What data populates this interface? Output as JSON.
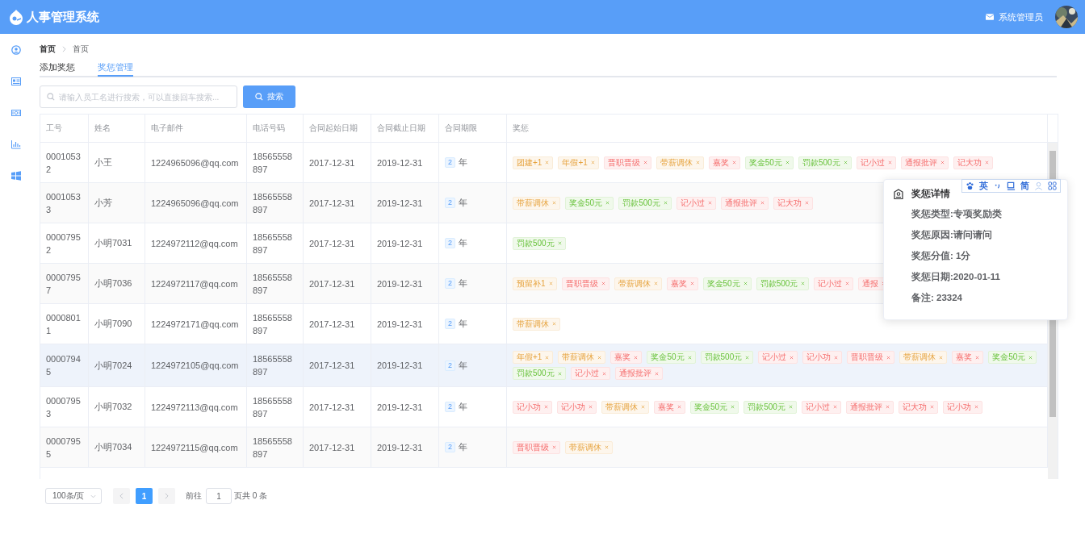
{
  "header": {
    "app_title": "人事管理系统",
    "user_name": "系统管理员"
  },
  "breadcrumb": [
    "首页",
    "首页"
  ],
  "tabs": [
    {
      "label": "添加奖惩",
      "selected": false
    },
    {
      "label": "奖惩管理",
      "selected": true
    }
  ],
  "search": {
    "placeholder": "请输入员工名进行搜索，可以直接回车搜索...",
    "button": "搜索"
  },
  "table": {
    "columns": [
      "工号",
      "姓名",
      "电子邮件",
      "电话号码",
      "合同起始日期",
      "合同截止日期",
      "合同期限",
      "奖惩"
    ],
    "rows": [
      {
        "id": "00010532",
        "name": "小王",
        "email": "1224965096@qq.com",
        "phone": "18565558897",
        "start": "2017-12-31",
        "end": "2019-12-31",
        "term": "2",
        "term_unit": "年",
        "hovered": false,
        "tags": [
          {
            "text": "团建+1",
            "color": "#fdf6ec"
          },
          {
            "text": "年假+1",
            "color": "#fdf6ec"
          },
          {
            "text": "晋职晋级",
            "color": "#fef0f0"
          },
          {
            "text": "带薪调休",
            "color": "#fdf6ec"
          },
          {
            "text": "嘉奖",
            "color": "#fef0f0"
          },
          {
            "text": "奖金50元",
            "color": "#f0f9eb"
          },
          {
            "text": "罚款500元",
            "color": "#f0f9eb"
          },
          {
            "text": "记小过",
            "color": "#fef0f0"
          },
          {
            "text": "通报批评",
            "color": "#fef0f0"
          },
          {
            "text": "记大功",
            "color": "#fef0f0"
          }
        ]
      },
      {
        "id": "00010533",
        "name": "小芳",
        "email": "1224965096@qq.com",
        "phone": "18565558897",
        "start": "2017-12-31",
        "end": "2019-12-31",
        "term": "2",
        "term_unit": "年",
        "hovered": false,
        "tags": [
          {
            "text": "带薪调休",
            "color": "#fdf6ec"
          },
          {
            "text": "奖金50元",
            "color": "#f0f9eb"
          },
          {
            "text": "罚款500元",
            "color": "#f0f9eb"
          },
          {
            "text": "记小过",
            "color": "#fef0f0"
          },
          {
            "text": "通报批评",
            "color": "#fef0f0"
          },
          {
            "text": "记大功",
            "color": "#fef0f0"
          }
        ]
      },
      {
        "id": "00007952",
        "name": "小明7031",
        "email": "1224972112@qq.com",
        "phone": "18565558897",
        "start": "2017-12-31",
        "end": "2019-12-31",
        "term": "2",
        "term_unit": "年",
        "hovered": false,
        "tags": [
          {
            "text": "罚款500元",
            "color": "#f0f9eb"
          }
        ]
      },
      {
        "id": "00007957",
        "name": "小明7036",
        "email": "1224972117@qq.com",
        "phone": "18565558897",
        "start": "2017-12-31",
        "end": "2019-12-31",
        "term": "2",
        "term_unit": "年",
        "hovered": false,
        "tags": [
          {
            "text": "预留补1",
            "color": "#fdf6ec"
          },
          {
            "text": "晋职晋级",
            "color": "#fef0f0"
          },
          {
            "text": "带薪调休",
            "color": "#fdf6ec"
          },
          {
            "text": "嘉奖",
            "color": "#fef0f0"
          },
          {
            "text": "奖金50元",
            "color": "#f0f9eb"
          },
          {
            "text": "罚款500元",
            "color": "#f0f9eb"
          },
          {
            "text": "记小过",
            "color": "#fef0f0"
          },
          {
            "text": "通报",
            "color": "#fef0f0"
          }
        ]
      },
      {
        "id": "00008011",
        "name": "小明7090",
        "email": "1224972171@qq.com",
        "phone": "18565558897",
        "start": "2017-12-31",
        "end": "2019-12-31",
        "term": "2",
        "term_unit": "年",
        "hovered": false,
        "tags": [
          {
            "text": "带薪调休",
            "color": "#fdf6ec"
          }
        ]
      },
      {
        "id": "00007945",
        "name": "小明7024",
        "email": "1224972105@qq.com",
        "phone": "18565558897",
        "start": "2017-12-31",
        "end": "2019-12-31",
        "term": "2",
        "term_unit": "年",
        "hovered": true,
        "tags": [
          {
            "text": "年假+1",
            "color": "#fdf6ec"
          },
          {
            "text": "带薪调休",
            "color": "#fdf6ec"
          },
          {
            "text": "嘉奖",
            "color": "#fef0f0"
          },
          {
            "text": "奖金50元",
            "color": "#f0f9eb"
          },
          {
            "text": "罚款500元",
            "color": "#f0f9eb"
          },
          {
            "text": "记小过",
            "color": "#fef0f0"
          },
          {
            "text": "记小功",
            "color": "#fef0f0"
          },
          {
            "text": "晋职晋级",
            "color": "#fef0f0"
          },
          {
            "text": "带薪调休",
            "color": "#fdf6ec"
          },
          {
            "text": "嘉奖",
            "color": "#fef0f0"
          },
          {
            "text": "奖金50元",
            "color": "#f0f9eb"
          },
          {
            "text": "罚款500元",
            "color": "#f0f9eb"
          },
          {
            "text": "记小过",
            "color": "#fef0f0"
          },
          {
            "text": "通报批评",
            "color": "#fef0f0"
          }
        ]
      },
      {
        "id": "00007953",
        "name": "小明7032",
        "email": "1224972113@qq.com",
        "phone": "18565558897",
        "start": "2017-12-31",
        "end": "2019-12-31",
        "term": "2",
        "term_unit": "年",
        "hovered": false,
        "tags": [
          {
            "text": "记小功",
            "color": "#fef0f0"
          },
          {
            "text": "记小功",
            "color": "#fef0f0"
          },
          {
            "text": "带薪调休",
            "color": "#fdf6ec"
          },
          {
            "text": "嘉奖",
            "color": "#fef0f0"
          },
          {
            "text": "奖金50元",
            "color": "#f0f9eb"
          },
          {
            "text": "罚款500元",
            "color": "#f0f9eb"
          },
          {
            "text": "记小过",
            "color": "#fef0f0"
          },
          {
            "text": "通报批评",
            "color": "#fef0f0"
          },
          {
            "text": "记大功",
            "color": "#fef0f0"
          },
          {
            "text": "记小功",
            "color": "#fef0f0"
          }
        ]
      },
      {
        "id": "00007955",
        "name": "小明7034",
        "email": "1224972115@qq.com",
        "phone": "18565558897",
        "start": "2017-12-31",
        "end": "2019-12-31",
        "term": "2",
        "term_unit": "年",
        "hovered": false,
        "tags": [
          {
            "text": "晋职晋级",
            "color": "#fef0f0"
          },
          {
            "text": "带薪调休",
            "color": "#fdf6ec"
          }
        ]
      }
    ]
  },
  "popover": {
    "title": "奖惩详情",
    "lines": [
      "奖惩类型:专项奖励类",
      "奖惩原因:请问请问",
      "奖惩分值: 1分",
      "奖惩日期:2020-01-11",
      "备注: 23324"
    ]
  },
  "ime_bar": {
    "labels": [
      "英",
      "简"
    ]
  },
  "pagination": {
    "page_size": "100条/页",
    "pages": [
      {
        "label": "1",
        "selected": true
      }
    ],
    "goto_label": "前往",
    "goto_value": "1",
    "total": "页共 0 条"
  }
}
